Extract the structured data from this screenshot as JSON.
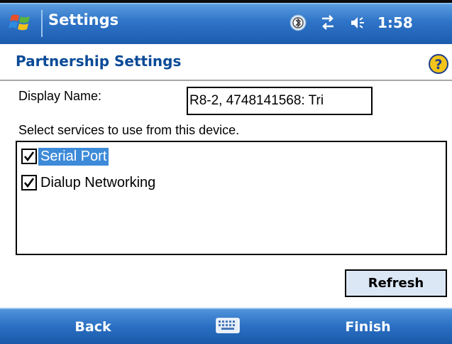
{
  "titlebar": {
    "app_title": "Settings",
    "time": "1:58",
    "icons": [
      "windows-start-icon",
      "bluetooth-icon",
      "connectivity-icon",
      "speaker-icon"
    ]
  },
  "header": {
    "title": "Partnership Settings",
    "help_icon": "help-icon"
  },
  "form": {
    "display_name_label": "Display Name:",
    "display_name_value": "R8-2, 4748141568: Tri",
    "services_label": "Select services to use from this device."
  },
  "services": [
    {
      "label": "Serial Port",
      "checked": true,
      "selected": true
    },
    {
      "label": "Dialup Networking",
      "checked": true,
      "selected": false
    }
  ],
  "refresh_button": "Refresh",
  "menubar": {
    "left_softkey": "Back",
    "right_softkey": "Finish",
    "sip_icon": "keyboard-icon"
  },
  "colors": {
    "titlebar": "#2f74c8",
    "header_text": "#0b4b97",
    "selection": "#3d8ad9",
    "button_bg": "#dce7f5"
  }
}
